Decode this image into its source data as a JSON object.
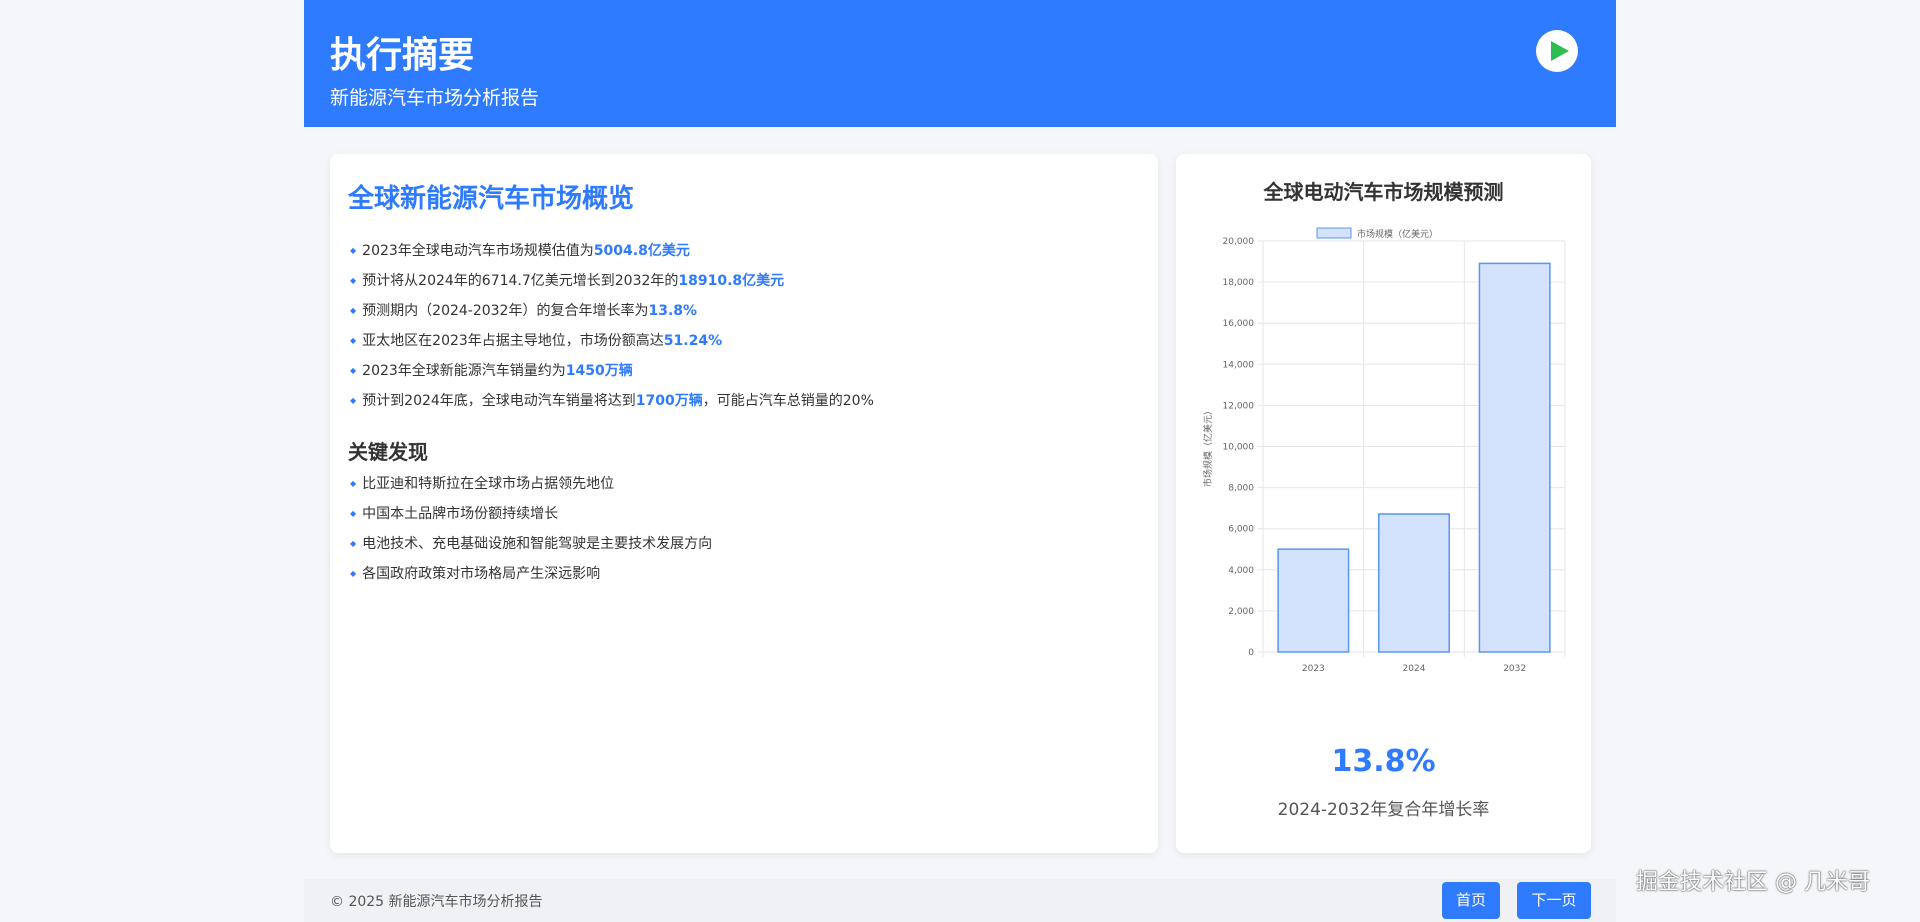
{
  "header": {
    "title": "执行摘要",
    "subtitle": "新能源汽车市场分析报告",
    "play_icon": "play-icon"
  },
  "overview": {
    "title": "全球新能源汽车市场概览",
    "items": [
      {
        "text": "2023年全球电动汽车市场规模估值为",
        "hl": "5004.8亿美元",
        "after": ""
      },
      {
        "text": "预计将从2024年的6714.7亿美元增长到2032年的",
        "hl": "18910.8亿美元",
        "after": ""
      },
      {
        "text": "预测期内（2024-2032年）的复合年增长率为",
        "hl": "13.8%",
        "after": ""
      },
      {
        "text": "亚太地区在2023年占据主导地位，市场份额高达",
        "hl": "51.24%",
        "after": ""
      },
      {
        "text": "2023年全球新能源汽车销量约为",
        "hl": "1450万辆",
        "after": ""
      },
      {
        "text": "预计到2024年底，全球电动汽车销量将达到",
        "hl": "1700万辆",
        "after": "，可能占汽车总销量的20%"
      }
    ]
  },
  "findings": {
    "title": "关键发现",
    "items": [
      "比亚迪和特斯拉在全球市场占据领先地位",
      "中国本土品牌市场份额持续增长",
      "电池技术、充电基础设施和智能驾驶是主要技术发展方向",
      "各国政府政策对市场格局产生深远影响"
    ]
  },
  "chart_data": {
    "type": "bar",
    "title": "全球电动汽车市场规模预测",
    "categories": [
      "2023",
      "2024",
      "2032"
    ],
    "series": [
      {
        "name": "市场规模（亿美元）",
        "values": [
          5004.8,
          6714.7,
          18910.8
        ]
      }
    ],
    "ylabel": "市场规模（亿美元）",
    "ylim": [
      0,
      20000
    ],
    "yticks": [
      "0",
      "2,000",
      "4,000",
      "6,000",
      "8,000",
      "10,000",
      "12,000",
      "14,000",
      "16,000",
      "18,000",
      "20,000"
    ],
    "grid": true,
    "legend": "top",
    "colors": {
      "fill": "#d3e3fd",
      "stroke": "#5b95f0"
    }
  },
  "stat": {
    "value": "13.8%",
    "label": "2024-2032年复合年增长率"
  },
  "footer": {
    "copyright": "© 2025 新能源汽车市场分析报告",
    "home": "首页",
    "next": "下一页"
  },
  "watermark": "掘金技术社区 @ 几米哥"
}
